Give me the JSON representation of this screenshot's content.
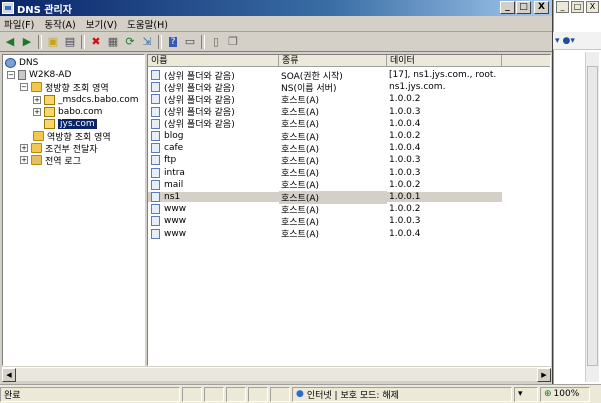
{
  "window": {
    "title": "DNS 관리자",
    "minimize": "_",
    "maximize": "□",
    "close": "X"
  },
  "menu": [
    "파일(F)",
    "동작(A)",
    "보기(V)",
    "도움말(H)"
  ],
  "toolbar": [
    "back-icon",
    "forward-icon",
    "up-icon",
    "show-tree-icon",
    "delete-icon",
    "properties-icon",
    "refresh-icon",
    "export-icon",
    "help-icon",
    "console-icon",
    "sep",
    "page-icon",
    "copy-icon"
  ],
  "tree": [
    {
      "label": "DNS",
      "level": 0,
      "expander": "",
      "icon": "dns"
    },
    {
      "label": "W2K8-AD",
      "level": 1,
      "expander": "−",
      "icon": "server"
    },
    {
      "label": "정방향 조회 영역",
      "level": 2,
      "expander": "−",
      "icon": "folder"
    },
    {
      "label": "_msdcs.babo.com",
      "level": 3,
      "expander": "+",
      "icon": "zone"
    },
    {
      "label": "babo.com",
      "level": 3,
      "expander": "+",
      "icon": "zone"
    },
    {
      "label": "jys.com",
      "level": 3,
      "expander": "",
      "icon": "zone",
      "selected": true
    },
    {
      "label": "역방향 조회 영역",
      "level": 2,
      "expander": "",
      "icon": "folder"
    },
    {
      "label": "조건부 전달자",
      "level": 2,
      "expander": "+",
      "icon": "folder"
    },
    {
      "label": "전역 로그",
      "level": 2,
      "expander": "+",
      "icon": "folder"
    }
  ],
  "list": {
    "columns": [
      "이름",
      "종류",
      "데이터"
    ],
    "rows": [
      {
        "name": "(상위 폴더와 같음)",
        "type": "SOA(권한 시작)",
        "data": "[17], ns1.jys.com., root."
      },
      {
        "name": "(상위 폴더와 같음)",
        "type": "NS(이름 서버)",
        "data": "ns1.jys.com."
      },
      {
        "name": "(상위 폴더와 같음)",
        "type": "호스트(A)",
        "data": "1.0.0.2"
      },
      {
        "name": "(상위 폴더와 같음)",
        "type": "호스트(A)",
        "data": "1.0.0.3"
      },
      {
        "name": "(상위 폴더와 같음)",
        "type": "호스트(A)",
        "data": "1.0.0.4"
      },
      {
        "name": "blog",
        "type": "호스트(A)",
        "data": "1.0.0.2"
      },
      {
        "name": "cafe",
        "type": "호스트(A)",
        "data": "1.0.0.4"
      },
      {
        "name": "ftp",
        "type": "호스트(A)",
        "data": "1.0.0.3"
      },
      {
        "name": "intra",
        "type": "호스트(A)",
        "data": "1.0.0.3"
      },
      {
        "name": "mail",
        "type": "호스트(A)",
        "data": "1.0.0.2"
      },
      {
        "name": "ns1",
        "type": "호스트(A)",
        "data": "1.0.0.1",
        "selected": true
      },
      {
        "name": "www",
        "type": "호스트(A)",
        "data": "1.0.0.2"
      },
      {
        "name": "www",
        "type": "호스트(A)",
        "data": "1.0.0.3"
      },
      {
        "name": "www",
        "type": "호스트(A)",
        "data": "1.0.0.4"
      }
    ]
  },
  "background": {
    "min": "_",
    "max": "□",
    "close": "X",
    "tools": [
      "▾",
      "●▾"
    ]
  },
  "statusbar": {
    "status": "완료",
    "zone": "인터넷 | 보호 모드: 해제",
    "zoom": "100%"
  }
}
